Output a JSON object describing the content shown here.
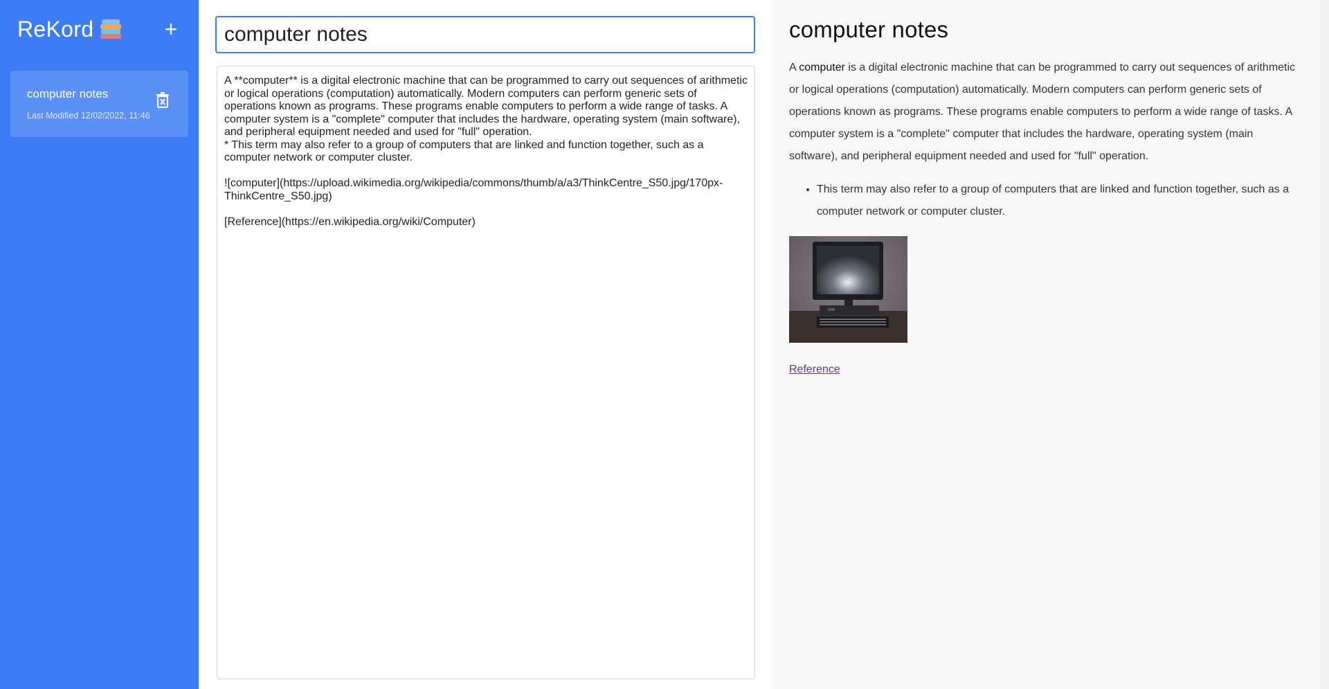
{
  "app": {
    "title": "ReKord",
    "logo_icon": "books-icon",
    "add_label": "+"
  },
  "sidebar": {
    "notes": [
      {
        "title": "computer notes",
        "last_modified": "Last Modified 12/02/2022, 11:46"
      }
    ]
  },
  "editor": {
    "title_value": "computer notes",
    "body_value": "A **computer** is a digital electronic machine that can be programmed to carry out sequences of arithmetic or logical operations (computation) automatically. Modern computers can perform generic sets of operations known as programs. These programs enable computers to perform a wide range of tasks. A computer system is a \"complete\" computer that includes the hardware, operating system (main software), and peripheral equipment needed and used for \"full\" operation.\n* This term may also refer to a group of computers that are linked and function together, such as a computer network or computer cluster.\n\n![computer](https://upload.wikimedia.org/wikipedia/commons/thumb/a/a3/ThinkCentre_S50.jpg/170px-ThinkCentre_S50.jpg)\n\n[Reference](https://en.wikipedia.org/wiki/Computer)"
  },
  "preview": {
    "title": "computer notes",
    "paragraph_prefix": "A ",
    "paragraph_bold": "computer",
    "paragraph_rest": " is a digital electronic machine that can be programmed to carry out sequences of arithmetic or logical operations (computation) automatically. Modern computers can perform generic sets of operations known as programs. These programs enable computers to perform a wide range of tasks. A computer system is a \"complete\" computer that includes the hardware, operating system (main software), and peripheral equipment needed and used for \"full\" operation.",
    "list_items": [
      "This term may also refer to a group of computers that are linked and function together, such as a computer network or computer cluster."
    ],
    "image_alt": "computer",
    "link_label": "Reference"
  },
  "colors": {
    "sidebar_bg": "#3e7cf5",
    "active_note_bg": "#5b90f6",
    "preview_bg": "#f8f8f8",
    "link": "#6a2d9a"
  }
}
